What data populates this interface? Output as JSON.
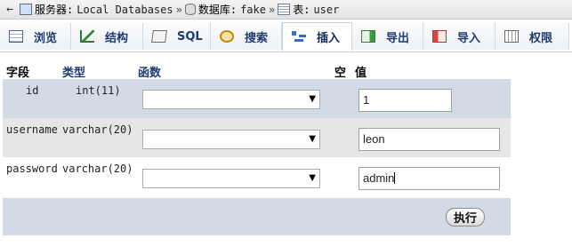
{
  "breadcrumb": {
    "back_icon": "←",
    "server_label": "服务器:",
    "server_name": "Local Databases",
    "separator": "»",
    "database_label": "数据库:",
    "database_name": "fake",
    "table_label": "表:",
    "table_name": "user"
  },
  "tabs": [
    {
      "label": "浏览",
      "icon": "browse-icon"
    },
    {
      "label": "结构",
      "icon": "structure-icon"
    },
    {
      "label": "SQL",
      "icon": "sql-icon"
    },
    {
      "label": "搜索",
      "icon": "search-icon"
    },
    {
      "label": "插入",
      "icon": "insert-icon",
      "active": true
    },
    {
      "label": "导出",
      "icon": "export-icon"
    },
    {
      "label": "导入",
      "icon": "import-icon"
    },
    {
      "label": "权限",
      "icon": "privileges-icon"
    }
  ],
  "table_header": {
    "field": "字段",
    "type": "类型",
    "function": "函数",
    "null": "空",
    "value": "值"
  },
  "rows": [
    {
      "field": "id",
      "type": "int(11)",
      "function": "",
      "value": "1"
    },
    {
      "field": "username",
      "type": "varchar(20)",
      "function": "",
      "value": "leon"
    },
    {
      "field": "password",
      "type": "varchar(20)",
      "function": "",
      "value": "admin"
    }
  ],
  "go_button": "执行",
  "colors": {
    "odd_row": "#d2dbe5",
    "even_row": "#e6e6e6",
    "link": "#1f3a6e"
  }
}
